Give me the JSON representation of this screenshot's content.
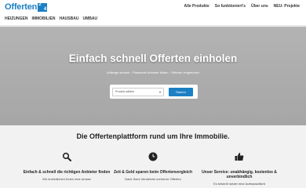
{
  "header": {
    "logo_text": "Offerten",
    "logo_box_top": "2",
    "logo_box_bottom": "4",
    "top_links": [
      "Alle Produkte",
      "So funktioniert's",
      "Über uns",
      "NEU: Projekte"
    ],
    "nav": [
      "Heizungen",
      "Immobilien",
      "Hausbau",
      "Umbau"
    ]
  },
  "hero": {
    "title": "Einfach schnell Offerten einholen",
    "subtitle": "Auftrage senden · Passende Anbieter finden · Offerten vergleichen",
    "select_value": "Produkt wählen",
    "button_label": "Starten"
  },
  "main": {
    "headline": "Die Offertenplattform rund um Ihre Immobilie.",
    "features": [
      {
        "icon": "search-icon",
        "title": "Einfach & schnell die richtigen Anbieter finden",
        "text": "Wir ermöglichen Ihnen eine grosse"
      },
      {
        "icon": "clock-icon",
        "title": "Zeit & Geld sparen beim Offertenvergleich",
        "text": "Dank Ihres Vergleichs mehrerer Offerten"
      },
      {
        "icon": "thumbs-up-icon",
        "title": "Unser Service: unabhängig, kostenlos & unverbindlich",
        "text": "Es besteht weder eine Auftragspflicht"
      }
    ]
  },
  "colors": {
    "brand": "#1b7fc4",
    "hero_bg": "#acacac"
  }
}
